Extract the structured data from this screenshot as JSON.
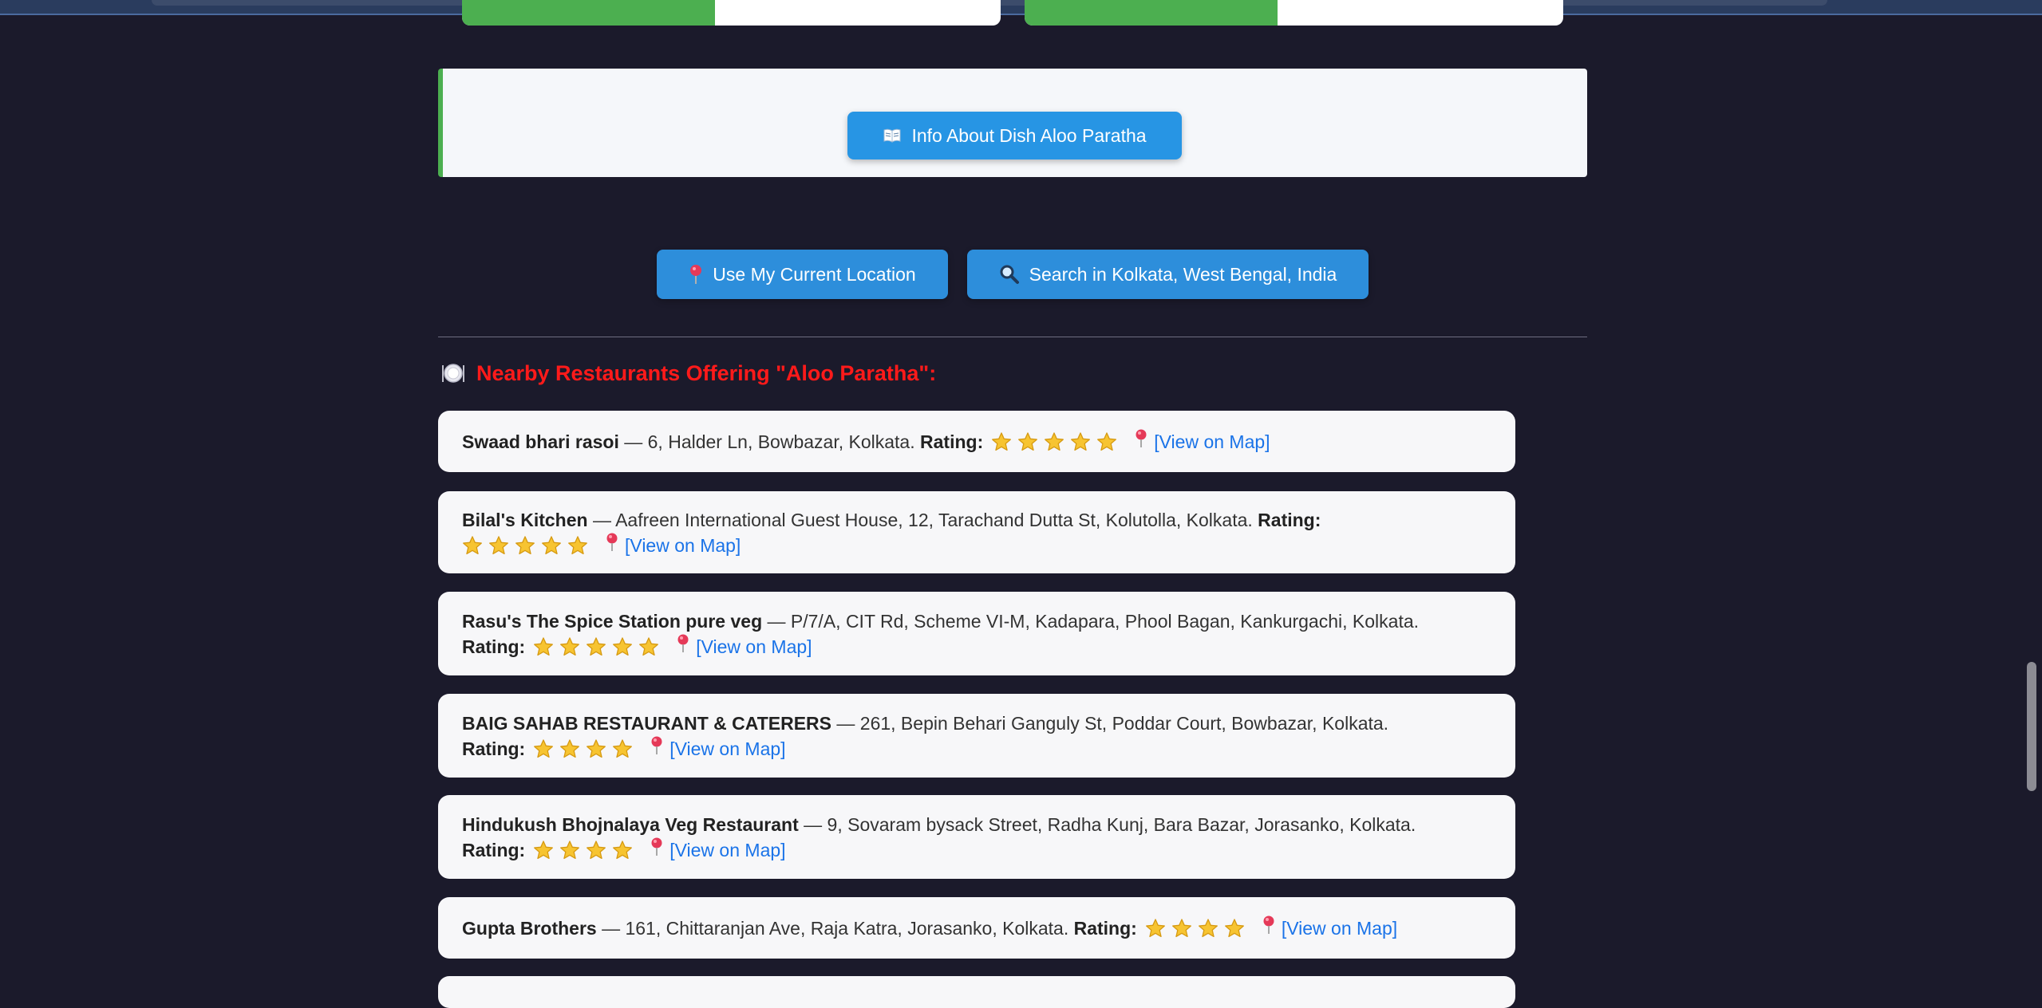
{
  "progress_bars": [
    {
      "fill_fraction": 0.47
    },
    {
      "fill_fraction": 0.47
    }
  ],
  "info_button": {
    "icon": "open-book-icon",
    "label": "Info About Dish Aloo Paratha"
  },
  "location_button": {
    "icon": "pin-icon",
    "label": "Use My Current Location"
  },
  "search_button": {
    "icon": "magnifier-icon",
    "label": "Search in Kolkata, West Bengal, India"
  },
  "heading": {
    "icon": "plate-icon",
    "text": "Nearby Restaurants Offering \"Aloo Paratha\":"
  },
  "rating_label": "Rating:",
  "map_link_label": "[View on Map]",
  "restaurants": [
    {
      "name": "Swaad bhari rasoi",
      "address": " — 6, Halder Ln, Bowbazar, Kolkata. ",
      "stars": 5
    },
    {
      "name": "Bilal's Kitchen",
      "address": " — Aafreen International Guest House, 12, Tarachand Dutta St, Kolutolla, Kolkata. ",
      "stars": 5
    },
    {
      "name": "Rasu's The Spice Station pure veg",
      "address": " — P/7/A, CIT Rd, Scheme VI-M, Kadapara, Phool Bagan, Kankurgachi, Kolkata.",
      "stars": 5
    },
    {
      "name": "BAIG SAHAB RESTAURANT & CATERERS",
      "address": " — 261, Bepin Behari Ganguly St, Poddar Court, Bowbazar, Kolkata.",
      "stars": 4
    },
    {
      "name": "Hindukush Bhojnalaya Veg Restaurant",
      "address": " — 9, Sovaram bysack Street, Radha Kunj, Bara Bazar, Jorasanko, Kolkata.",
      "stars": 4
    },
    {
      "name": "Gupta Brothers",
      "address": " — 161, Chittaranjan Ave, Raja Katra, Jorasanko, Kolkata. ",
      "stars": 4
    }
  ],
  "colors": {
    "background": "#1b1a2b",
    "button": "#2795e4",
    "heading": "#ff1a1a",
    "link": "#1a73e8",
    "progress": "#4caf50"
  }
}
